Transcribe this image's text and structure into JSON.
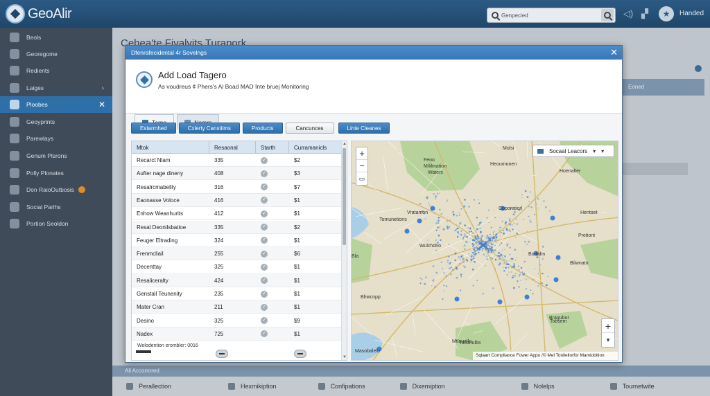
{
  "app": {
    "name": "GeoAlir"
  },
  "topbar": {
    "search_placeholder": "Genpecied",
    "user_name": "Handed"
  },
  "sidebar": {
    "items": [
      {
        "label": "Beols",
        "icon": "plus-icon",
        "active": false
      },
      {
        "label": "Georegome",
        "icon": "globe-icon",
        "active": false
      },
      {
        "label": "Redients",
        "icon": "layers-icon",
        "active": false
      },
      {
        "label": "Laiges",
        "icon": "cloud-icon",
        "active": false,
        "arrow": "›"
      },
      {
        "label": "Ploobes",
        "icon": "map-icon",
        "active": true,
        "close": "✕"
      },
      {
        "label": "Geoyprints",
        "icon": "pin-icon",
        "active": false
      },
      {
        "label": "Parewlays",
        "icon": "route-icon",
        "active": false
      },
      {
        "label": "Genum Plsrons",
        "icon": "clock-icon",
        "active": false
      },
      {
        "label": "Polly Plonates",
        "icon": "people-icon",
        "active": false
      },
      {
        "label": "Don RaioOutbosis",
        "icon": "share-icon",
        "active": false,
        "badge": true
      },
      {
        "label": "Social Parlhs",
        "icon": "chart-icon",
        "active": false
      },
      {
        "label": "Portion Seoldon",
        "icon": "table-icon",
        "active": false
      }
    ]
  },
  "background_page": {
    "title": "Cehea'te Fivalvits Turapork",
    "right_header": "Eoned",
    "bottom_bar_label": "All Accorrored",
    "bottom_nav": [
      "Perallection",
      "Hexmikiption",
      "Confipations",
      "Dixemiption",
      "Nolelps",
      "Tournetwite"
    ]
  },
  "modal": {
    "title": "Dfenrafecidental 4r Sovelngs",
    "close": "✕",
    "heading": "Add Load Tagero",
    "subheading": "As voudreus ¢ Phers's Al Boad MAD Inte bruej Monitoring",
    "tabs": [
      {
        "label": "Terne",
        "active": true
      },
      {
        "label": "Nemrs",
        "active": false
      }
    ],
    "actions": [
      {
        "label": "Estarmhed",
        "primary": true
      },
      {
        "label": "Cxlerty Canstiims",
        "primary": true
      },
      {
        "label": "Products",
        "primary": true
      },
      {
        "label": "Cancunces",
        "primary": false
      },
      {
        "label": "Linte Cleanes",
        "primary": true
      }
    ],
    "table": {
      "columns": [
        "Mtok",
        "Resaonal",
        "Starth",
        "Curramanicls"
      ],
      "rows": [
        [
          "Recarct Nlam",
          "335",
          "✓",
          "$2"
        ],
        [
          "Aufter nage dineny",
          "408",
          "✓",
          "$3"
        ],
        [
          "Resalrcmabelity",
          "316",
          "✓",
          "$7"
        ],
        [
          "Eaonasse Voloce",
          "416",
          "✓",
          "$1"
        ],
        [
          "Enhow Weanhurits",
          "412",
          "✓",
          "$1"
        ],
        [
          "Resal Deonilsbatioe",
          "335",
          "✓",
          "$2"
        ],
        [
          "Feuger Eltrading",
          "324",
          "✓",
          "$1"
        ],
        [
          "Frenmcliail",
          "255",
          "✓",
          "$6"
        ],
        [
          "Decenttay",
          "325",
          "✓",
          "$1"
        ],
        [
          "Resaliceralty",
          "424",
          "✓",
          "$1"
        ],
        [
          "Genstall Teunenity",
          "235",
          "✓",
          "$1"
        ],
        [
          "Mater Cran",
          "211",
          "✓",
          "$1"
        ],
        [
          "Desino",
          "325",
          "✓",
          "$9"
        ],
        [
          "Nadex",
          "725",
          "✓",
          "$1"
        ]
      ],
      "footer_note": "Wolodention erombler: 0016"
    },
    "map": {
      "layer_select": "Socaal Leacors",
      "labels": [
        "Feoo",
        "Mililmation",
        "Waters",
        "Coporation",
        "Wulchdno",
        "Bortalm",
        "Pretiont",
        "Bla",
        "Bilwnatn",
        "Bragubor",
        "Tobsem",
        "Bhwcnpp",
        "Mtlauallo",
        "Molsi",
        "Masobalelo",
        "Tocbnulbs",
        "Tomunetions",
        "Vratamon",
        "Hentoet",
        "Heoumonen",
        "Hoenalter"
      ],
      "footer": "Sqlaart Compliance Fower Appo /© Mel Tonilellorfor Mamiobition"
    }
  },
  "colors": {
    "accent": "#2f6fa8",
    "topbar": "#1f4669",
    "sidebar": "#3f4b59",
    "map_land": "#e6dfc9",
    "map_green": "#b7d39b",
    "map_water": "#a9cfe6",
    "dots": "#3f7fd6"
  }
}
